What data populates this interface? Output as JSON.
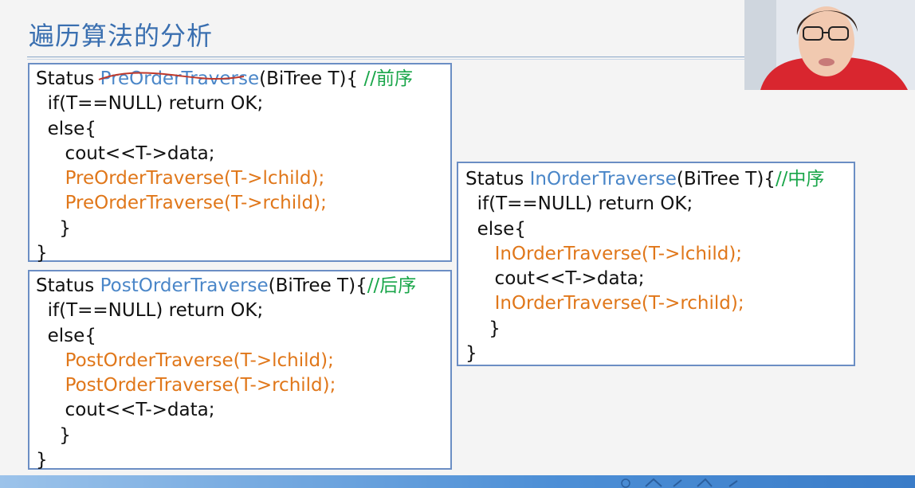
{
  "slide": {
    "title": "遍历算法的分析"
  },
  "preorder": {
    "lines": [
      [
        {
          "t": "Status ",
          "c": ""
        },
        {
          "t": "PreOrderTraverse",
          "c": "fn-name"
        },
        {
          "t": "(BiTree T){ ",
          "c": ""
        },
        {
          "t": "//前序",
          "c": "comment"
        }
      ],
      [
        {
          "t": "  if(T==NULL) return OK;",
          "c": ""
        }
      ],
      [
        {
          "t": "  else{",
          "c": ""
        }
      ],
      [
        {
          "t": "     cout<<T->data;",
          "c": ""
        }
      ],
      [
        {
          "t": "     ",
          "c": ""
        },
        {
          "t": "PreOrderTraverse(T->lchild);",
          "c": "call"
        }
      ],
      [
        {
          "t": "     ",
          "c": ""
        },
        {
          "t": "PreOrderTraverse(T->rchild);",
          "c": "call"
        }
      ],
      [
        {
          "t": "    }",
          "c": ""
        }
      ],
      [
        {
          "t": "}",
          "c": ""
        }
      ]
    ]
  },
  "postorder": {
    "lines": [
      [
        {
          "t": "Status ",
          "c": ""
        },
        {
          "t": "PostOrderTraverse",
          "c": "fn-name"
        },
        {
          "t": "(BiTree T){",
          "c": ""
        },
        {
          "t": "//后序",
          "c": "comment"
        }
      ],
      [
        {
          "t": "  if(T==NULL) return OK;",
          "c": ""
        }
      ],
      [
        {
          "t": "  else{",
          "c": ""
        }
      ],
      [
        {
          "t": "     ",
          "c": ""
        },
        {
          "t": "PostOrderTraverse(T->lchild);",
          "c": "call"
        }
      ],
      [
        {
          "t": "     ",
          "c": ""
        },
        {
          "t": "PostOrderTraverse(T->rchild);",
          "c": "call"
        }
      ],
      [
        {
          "t": "     cout<<T->data;",
          "c": ""
        }
      ],
      [
        {
          "t": "    }",
          "c": ""
        }
      ],
      [
        {
          "t": "}",
          "c": ""
        }
      ]
    ]
  },
  "inorder": {
    "lines": [
      [
        {
          "t": "Status ",
          "c": ""
        },
        {
          "t": "InOrderTraverse",
          "c": "fn-name"
        },
        {
          "t": "(BiTree T){",
          "c": ""
        },
        {
          "t": "//中序",
          "c": "comment"
        }
      ],
      [
        {
          "t": "  if(T==NULL) return OK;",
          "c": ""
        }
      ],
      [
        {
          "t": "  else{",
          "c": ""
        }
      ],
      [
        {
          "t": "     ",
          "c": ""
        },
        {
          "t": "InOrderTraverse(T->lchild);",
          "c": "call"
        }
      ],
      [
        {
          "t": "     cout<<T->data;",
          "c": ""
        }
      ],
      [
        {
          "t": "     ",
          "c": ""
        },
        {
          "t": "InOrderTraverse(T->rchild);",
          "c": "call"
        }
      ],
      [
        {
          "t": "    }",
          "c": ""
        }
      ],
      [
        {
          "t": "}",
          "c": ""
        }
      ]
    ]
  },
  "colors": {
    "function_name": "#4a86c8",
    "recursive_call": "#e0771a",
    "comment": "#1aa64a",
    "box_border": "#6b8ec4",
    "title": "#3a6fb0",
    "annotation_underline": "#c0392b"
  }
}
